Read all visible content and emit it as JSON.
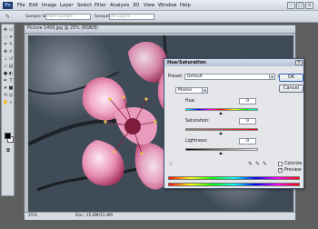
{
  "menubar": {
    "logo": "Ps",
    "items": [
      "File",
      "Edit",
      "Image",
      "Layer",
      "Select",
      "Filter",
      "Analysis",
      "3D",
      "View",
      "Window",
      "Help"
    ],
    "window_buttons": [
      "–",
      "□",
      "×"
    ]
  },
  "options_bar": {
    "sample_size_label": "Sample Size:",
    "sample_size_value": "Point Sample",
    "sample_label": "Sample:",
    "sample_value": "All Layers"
  },
  "document": {
    "title": "Picture 1459.jpg @ 25% (RGB/8)",
    "zoom": "25%",
    "doc_info": "Doc: 15.8M/15.8M"
  },
  "dialog": {
    "title": "Hue/Saturation",
    "close": "×",
    "preset_label": "Preset:",
    "preset_value": "Default",
    "channel_value": "Master",
    "hue_label": "Hue:",
    "hue_value": "0",
    "saturation_label": "Saturation:",
    "saturation_value": "0",
    "lightness_label": "Lightness:",
    "lightness_value": "0",
    "ok": "OK",
    "cancel": "Cancel",
    "colorize": "Colorize",
    "preview": "Preview",
    "colorize_checked": false,
    "preview_checked": true
  },
  "colors": {
    "accent": "#2f64b8",
    "fg_swatch": "#000000",
    "bg_swatch": "#ffffff"
  }
}
